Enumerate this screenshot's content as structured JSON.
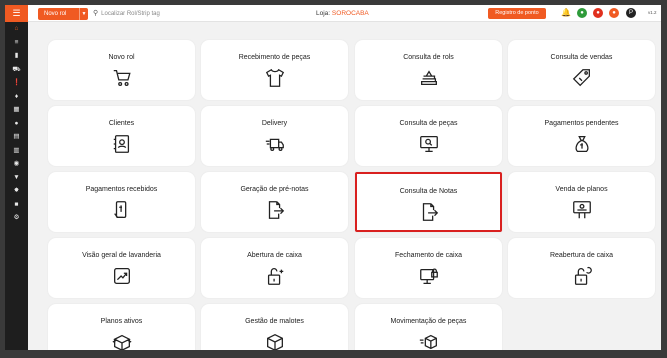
{
  "topbar": {
    "menu_icon": "hamburger-icon",
    "novo_rol_label": "Novo rol",
    "search_placeholder": "Localizar Rol/Strip tag",
    "loja_label": "Loja:",
    "loja_name": "SOROCABA",
    "registro_label": "Registro de ponto",
    "version": "v1.2",
    "avatar_letter": "P"
  },
  "sidebar": {
    "icons": [
      "home-icon",
      "list-icon",
      "tag-icon",
      "truck-icon",
      "alert-icon",
      "pricetag-icon",
      "book-icon",
      "user-icon",
      "document-icon",
      "receipt-icon",
      "cash-icon",
      "filter-icon",
      "gear-group-icon",
      "square-icon",
      "settings-icon"
    ]
  },
  "cards": [
    {
      "label": "Novo rol",
      "icon": "cart-icon"
    },
    {
      "label": "Recebimento de peças",
      "icon": "shirt-icon"
    },
    {
      "label": "Consulta de rols",
      "icon": "clothes-stack-icon"
    },
    {
      "label": "Consulta de vendas",
      "icon": "price-tag-icon"
    },
    {
      "label": "Clientes",
      "icon": "contacts-book-icon"
    },
    {
      "label": "Delivery",
      "icon": "delivery-truck-icon"
    },
    {
      "label": "Consulta de peças",
      "icon": "monitor-search-icon"
    },
    {
      "label": "Pagamentos pendentes",
      "icon": "money-bag-icon"
    },
    {
      "label": "Pagamentos recebidos",
      "icon": "mobile-payment-icon"
    },
    {
      "label": "Geração de pré-notas",
      "icon": "document-export-icon"
    },
    {
      "label": "Consulta de Notas",
      "icon": "document-export-icon"
    },
    {
      "label": "Venda de planos",
      "icon": "plan-board-icon"
    },
    {
      "label": "Visão geral de lavanderia",
      "icon": "chart-growth-icon"
    },
    {
      "label": "Abertura de caixa",
      "icon": "padlock-open-icon"
    },
    {
      "label": "Fechamento de caixa",
      "icon": "monitor-lock-icon"
    },
    {
      "label": "Reabertura de caixa",
      "icon": "padlock-refresh-icon"
    },
    {
      "label": "Planos ativos",
      "icon": "box-open-icon"
    },
    {
      "label": "Gestão de malotes",
      "icon": "box-icon"
    },
    {
      "label": "Movimentação de peças",
      "icon": "box-move-icon"
    }
  ],
  "colors": {
    "accent": "#f05a22",
    "selected_border": "#d9201f"
  }
}
